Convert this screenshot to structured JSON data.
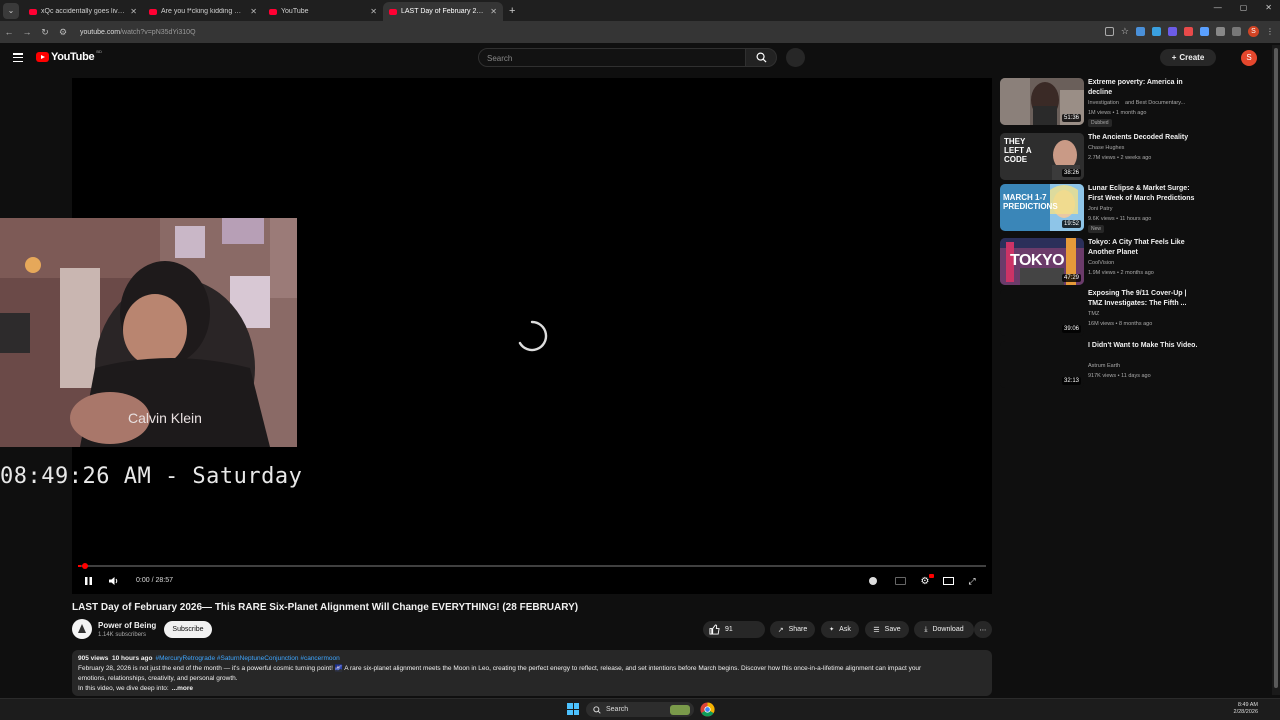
{
  "browser": {
    "tabs": [
      {
        "title": "xQc accidentally goes live with",
        "active": false
      },
      {
        "title": "Are you f*cking kidding me.. -",
        "active": false
      },
      {
        "title": "YouTube",
        "active": false
      },
      {
        "title": "LAST Day of February 2026— T",
        "active": true
      }
    ],
    "url_host": "youtube.com",
    "url_path": "/watch?v=pN35dYi310Q"
  },
  "header": {
    "logo_text": "YouTube",
    "logo_superscript": "BD",
    "search_placeholder": "Search",
    "create_label": "Create",
    "avatar_letter": "S"
  },
  "player": {
    "time_current": "0:00",
    "time_total": "28:57",
    "time_display": "0:00 / 28:57",
    "progress_fraction": 0.003
  },
  "overlay": {
    "shirt_text": "Calvin Klein",
    "clock_text": "08:49:26 AM - Saturday"
  },
  "video": {
    "title": "LAST Day of February 2026— This RARE Six-Planet Alignment Will Change EVERYTHING! (28 FEBRUARY)",
    "channel": "Power of Being",
    "subscribers": "1.14K subscribers",
    "subscribe_label": "Subscribe",
    "likes": "91",
    "share_label": "Share",
    "ask_label": "Ask",
    "save_label": "Save",
    "download_label": "Download"
  },
  "description": {
    "views": "905 views",
    "age": "10 hours ago",
    "tags": "#MercuryRetrograde #SaturnNeptuneConjunction #cancermoon",
    "line1": "February 28, 2026 is not just the end of the month — it's a powerful cosmic turning point! 🌌 A rare six-planet alignment meets the Moon in Leo, creating the perfect energy to reflect, release, and set intentions before March begins. Discover how this once-in-a-lifetime alignment can impact your",
    "line2": "emotions, relationships, creativity, and personal growth.",
    "line3": "In this video, we dive deep into:",
    "more_label": "...more"
  },
  "recommendations": [
    {
      "title": "Extreme poverty: America in decline",
      "channel": "Investigation",
      "channel_extra": "and Best Documentary...",
      "stats": "1M views • 1 month ago",
      "duration": "51:36",
      "badge": "Dubbed",
      "thumb_text": ""
    },
    {
      "title": "The Ancients Decoded Reality",
      "channel": "Chase Hughes",
      "channel_extra": "",
      "stats": "2.7M views • 2 weeks ago",
      "duration": "38:26",
      "badge": "",
      "thumb_text": "THEY LEFT A CODE"
    },
    {
      "title": "Lunar Eclipse & Market Surge: First Week of March Predictions",
      "channel": "Joni Patry",
      "channel_extra": "",
      "stats": "9.6K views • 11 hours ago",
      "duration": "19:52",
      "badge": "New",
      "thumb_text": "MARCH 1-7 PREDICTIONS"
    },
    {
      "title": "Tokyo: A City That Feels Like Another Planet",
      "channel": "CoolVision",
      "channel_extra": "",
      "stats": "1.9M views • 2 months ago",
      "duration": "47:29",
      "badge": "",
      "thumb_text": "TOKYO"
    },
    {
      "title": "Exposing The 9/11 Cover-Up | TMZ Investigates: The Fifth ...",
      "channel": "TMZ",
      "channel_extra": "",
      "stats": "16M views • 8 months ago",
      "duration": "39:06",
      "badge": "",
      "thumb_text": ""
    },
    {
      "title": "I Didn't Want to Make This Video.",
      "channel": "Astrum Earth",
      "channel_extra": "",
      "stats": "917K views • 11 days ago",
      "duration": "32:13",
      "badge": "",
      "thumb_text": ""
    }
  ],
  "taskbar": {
    "search_label": "Search",
    "time": "8:49 AM",
    "date": "2/28/2026"
  },
  "colors": {
    "background": "#0f0f0f",
    "accent_red": "#ff0000",
    "link_blue": "#3ea6ff",
    "chip_bg": "#272727"
  }
}
